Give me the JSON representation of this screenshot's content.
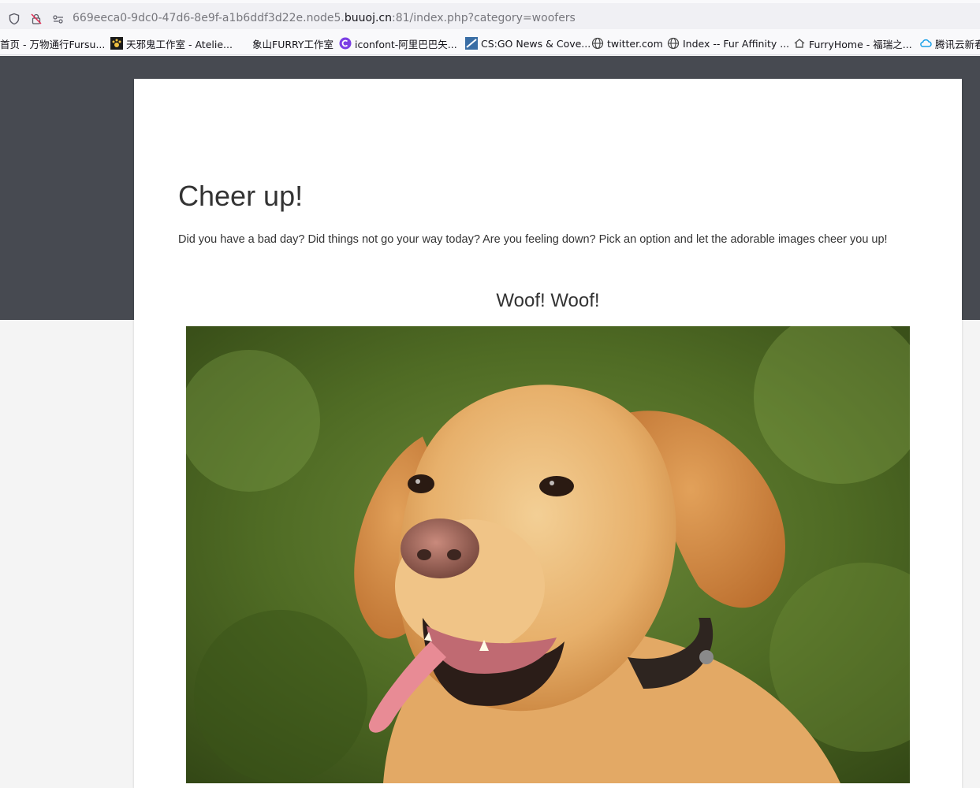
{
  "browser": {
    "url_prefix": "669eeca0-9dc0-47d6-8e9f-a1b6ddf3d22e.node5.",
    "url_host": "buuoj.cn",
    "url_suffix": ":81/index.php?category=woofers",
    "bookmarks": [
      "首页 - 万物通行Fursu...",
      "天邪鬼工作室 - Atelie...",
      "象山FURRY工作室",
      "iconfont-阿里巴巴矢...",
      "CS:GO News & Cove...",
      "twitter.com",
      "Index -- Fur Affinity ...",
      "FurryHome - 福瑞之...",
      "腾讯云新春"
    ]
  },
  "page": {
    "title": "Cheer up!",
    "lead": "Did you have a bad day? Did things not go your way today? Are you feeling down? Pick an option and let the adorable images cheer you up!",
    "subtitle": "Woof! Woof!"
  },
  "colors": {
    "hero": "#474a51",
    "text": "#333333"
  }
}
